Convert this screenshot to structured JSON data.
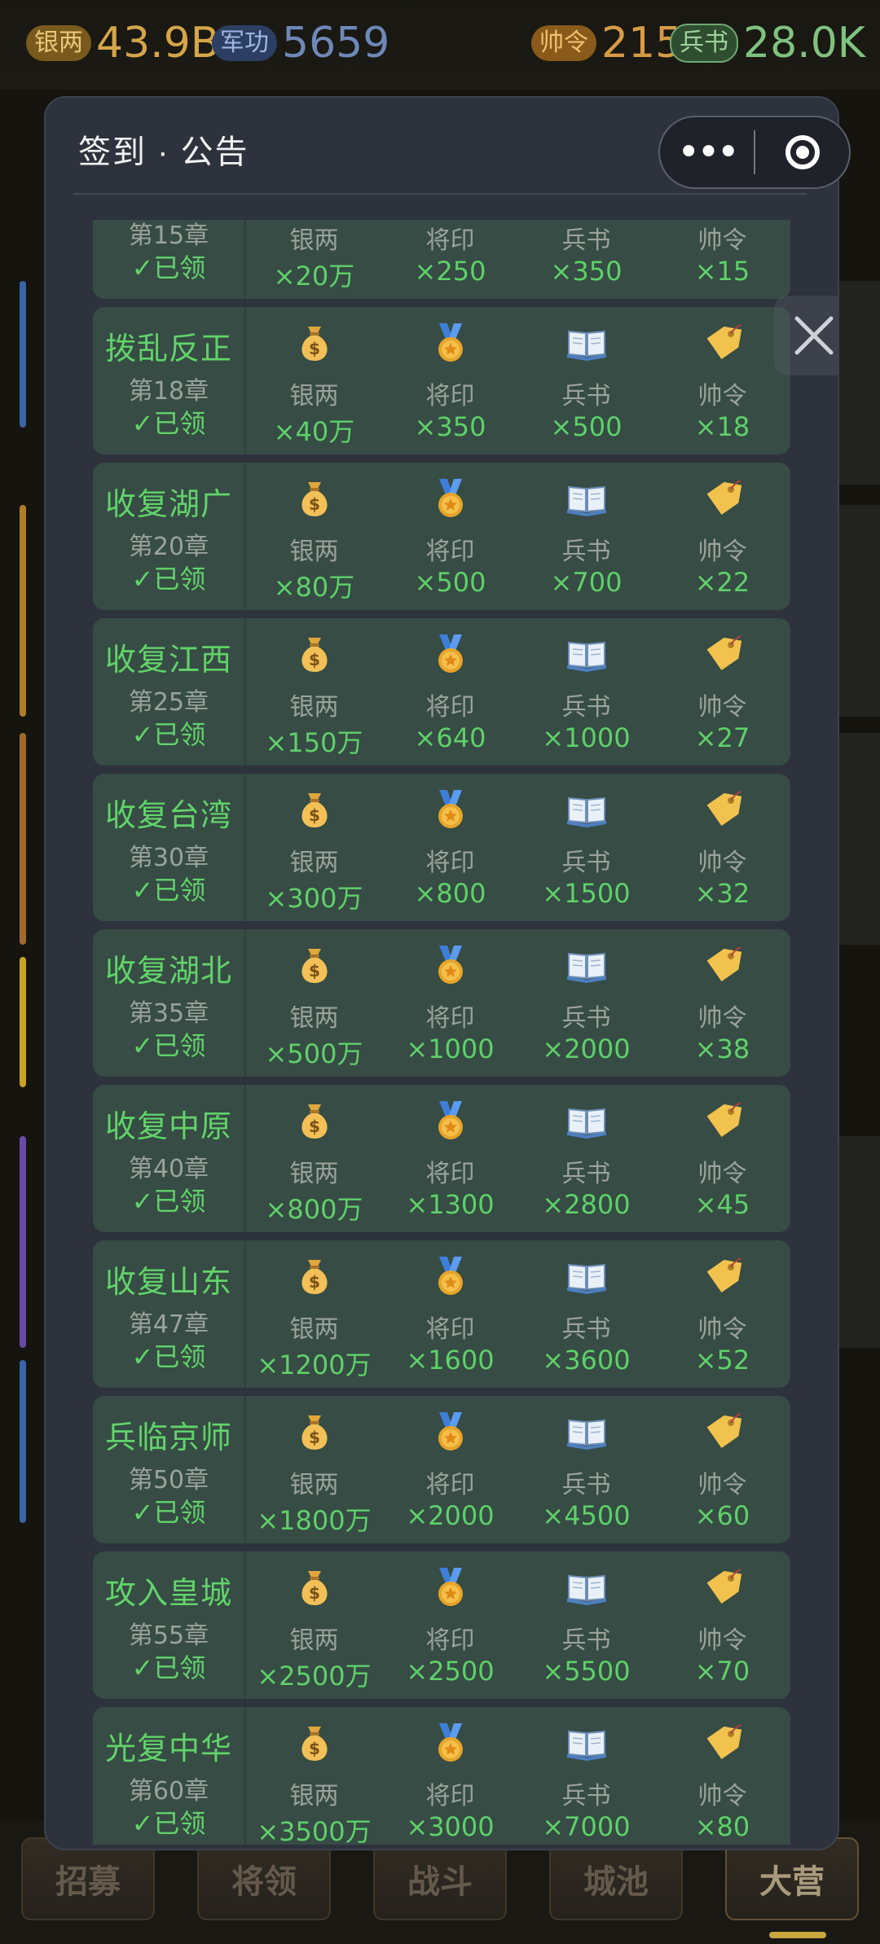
{
  "resources": {
    "silver": {
      "tag": "银两",
      "value": "43.9B"
    },
    "merit": {
      "tag": "军功",
      "value": "5659"
    },
    "order": {
      "tag": "帅令",
      "value": "215"
    },
    "book": {
      "tag": "兵书",
      "value": "28.0K"
    }
  },
  "modal": {
    "title": "签到 · 公告",
    "more_label": "•••"
  },
  "reward_labels": [
    "银两",
    "将印",
    "兵书",
    "帅令"
  ],
  "claimed_label": "✓已领",
  "rows": [
    {
      "name": "",
      "chapter": "第15章",
      "rewards": [
        "×20万",
        "×250",
        "×350",
        "×15"
      ]
    },
    {
      "name": "拨乱反正",
      "chapter": "第18章",
      "rewards": [
        "×40万",
        "×350",
        "×500",
        "×18"
      ]
    },
    {
      "name": "收复湖广",
      "chapter": "第20章",
      "rewards": [
        "×80万",
        "×500",
        "×700",
        "×22"
      ]
    },
    {
      "name": "收复江西",
      "chapter": "第25章",
      "rewards": [
        "×150万",
        "×640",
        "×1000",
        "×27"
      ]
    },
    {
      "name": "收复台湾",
      "chapter": "第30章",
      "rewards": [
        "×300万",
        "×800",
        "×1500",
        "×32"
      ]
    },
    {
      "name": "收复湖北",
      "chapter": "第35章",
      "rewards": [
        "×500万",
        "×1000",
        "×2000",
        "×38"
      ]
    },
    {
      "name": "收复中原",
      "chapter": "第40章",
      "rewards": [
        "×800万",
        "×1300",
        "×2800",
        "×45"
      ]
    },
    {
      "name": "收复山东",
      "chapter": "第47章",
      "rewards": [
        "×1200万",
        "×1600",
        "×3600",
        "×52"
      ]
    },
    {
      "name": "兵临京师",
      "chapter": "第50章",
      "rewards": [
        "×1800万",
        "×2000",
        "×4500",
        "×60"
      ]
    },
    {
      "name": "攻入皇城",
      "chapter": "第55章",
      "rewards": [
        "×2500万",
        "×2500",
        "×5500",
        "×70"
      ]
    },
    {
      "name": "光复中华",
      "chapter": "第60章",
      "rewards": [
        "×3500万",
        "×3000",
        "×7000",
        "×80"
      ]
    }
  ],
  "tabs": [
    "招募",
    "将领",
    "战斗",
    "城池",
    "大营"
  ]
}
